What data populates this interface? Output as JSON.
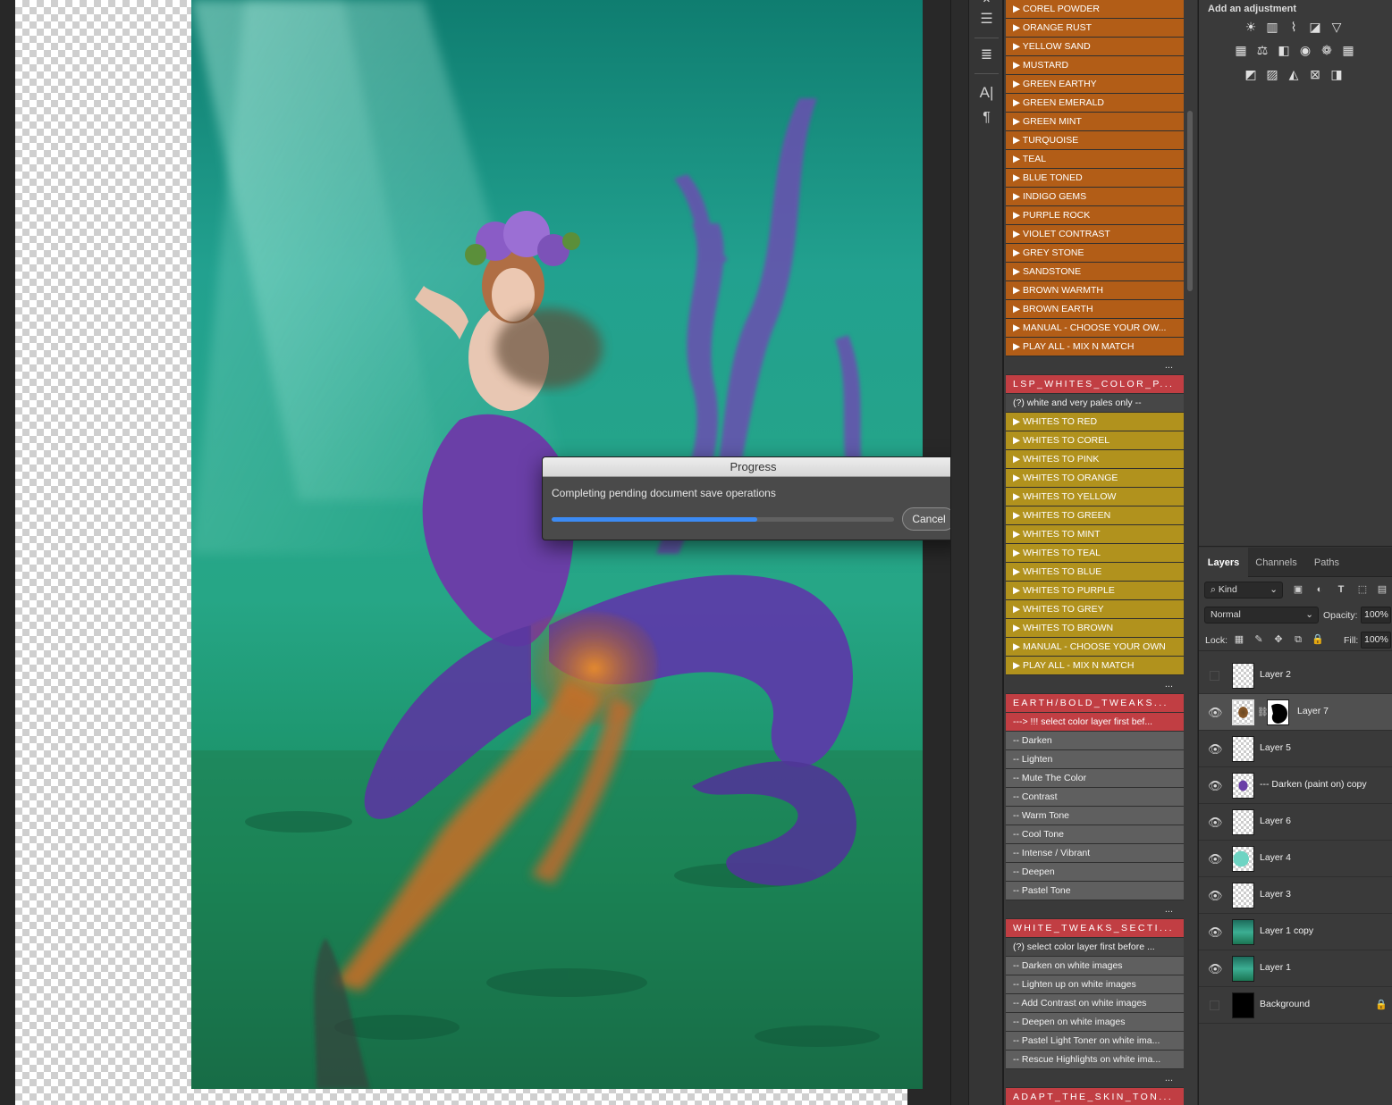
{
  "progress_dialog": {
    "title": "Progress",
    "message": "Completing pending document save operations",
    "progress_fraction": 0.6,
    "cancel_label": "Cancel"
  },
  "tool_dock": {
    "icons": [
      "history-icon",
      "properties-sliders-icon",
      "stamp-list-icon",
      "character-icon",
      "paragraph-icon"
    ]
  },
  "actions": {
    "more_label": "...",
    "rows": [
      {
        "label": "▶ COREL POWDER",
        "style": "orange"
      },
      {
        "label": "▶ ORANGE RUST",
        "style": "orange"
      },
      {
        "label": "▶ YELLOW SAND",
        "style": "orange"
      },
      {
        "label": "▶ MUSTARD",
        "style": "orange"
      },
      {
        "label": "▶ GREEN EARTHY",
        "style": "orange"
      },
      {
        "label": "▶ GREEN EMERALD",
        "style": "orange"
      },
      {
        "label": "▶ GREEN MINT",
        "style": "orange"
      },
      {
        "label": "▶ TURQUOISE",
        "style": "orange"
      },
      {
        "label": "▶ TEAL",
        "style": "orange"
      },
      {
        "label": "▶ BLUE TONED",
        "style": "orange"
      },
      {
        "label": "▶ INDIGO GEMS",
        "style": "orange"
      },
      {
        "label": "▶ PURPLE ROCK",
        "style": "orange"
      },
      {
        "label": "▶ VIOLET CONTRAST",
        "style": "orange"
      },
      {
        "label": "▶ GREY STONE",
        "style": "orange"
      },
      {
        "label": "▶ SANDSTONE",
        "style": "orange"
      },
      {
        "label": "▶ BROWN WARMTH",
        "style": "orange"
      },
      {
        "label": "▶ BROWN EARTH",
        "style": "orange"
      },
      {
        "label": "▶ MANUAL - CHOOSE YOUR OW...",
        "style": "orange"
      },
      {
        "label": "▶ PLAY ALL - MIX N MATCH",
        "style": "orange"
      },
      {
        "label": "...",
        "style": "more"
      },
      {
        "label": "LSP_WHITES_COLOR_P...",
        "style": "red"
      },
      {
        "label": "(?) white and very pales only --",
        "style": "dark"
      },
      {
        "label": "▶ WHITES TO  RED",
        "style": "mustard"
      },
      {
        "label": "▶ WHITES TO  COREL",
        "style": "mustard"
      },
      {
        "label": "▶ WHITES TO  PINK",
        "style": "mustard"
      },
      {
        "label": "▶ WHITES TO  ORANGE",
        "style": "mustard"
      },
      {
        "label": "▶ WHITES TO  YELLOW",
        "style": "mustard"
      },
      {
        "label": "▶ WHITES TO  GREEN",
        "style": "mustard"
      },
      {
        "label": "▶  WHITES TO  MINT",
        "style": "mustard"
      },
      {
        "label": "▶ WHITES TO  TEAL",
        "style": "mustard"
      },
      {
        "label": "▶ WHITES TO   BLUE",
        "style": "mustard"
      },
      {
        "label": "▶ WHITES TO  PURPLE",
        "style": "mustard"
      },
      {
        "label": "▶ WHITES TO  GREY",
        "style": "mustard"
      },
      {
        "label": "▶ WHITES TO  BROWN",
        "style": "mustard"
      },
      {
        "label": "▶ MANUAL - CHOOSE YOUR OWN",
        "style": "mustard"
      },
      {
        "label": "▶ PLAY ALL - MIX N MATCH",
        "style": "mustard"
      },
      {
        "label": "...",
        "style": "more"
      },
      {
        "label": "EARTH/BOLD_TWEAKS...",
        "style": "red"
      },
      {
        "label": "---> !!! select color layer first bef...",
        "style": "red-plain"
      },
      {
        "label": "-- Darken",
        "style": "gray"
      },
      {
        "label": "-- Lighten",
        "style": "gray"
      },
      {
        "label": "-- Mute The Color",
        "style": "gray"
      },
      {
        "label": "-- Contrast",
        "style": "gray"
      },
      {
        "label": "-- Warm Tone",
        "style": "gray"
      },
      {
        "label": "-- Cool Tone",
        "style": "gray"
      },
      {
        "label": "-- Intense / Vibrant",
        "style": "gray"
      },
      {
        "label": "-- Deepen",
        "style": "gray"
      },
      {
        "label": "-- Pastel Tone",
        "style": "gray"
      },
      {
        "label": "...",
        "style": "more"
      },
      {
        "label": "WHITE_TWEAKS_SECTI...",
        "style": "red"
      },
      {
        "label": "(?)  select color layer first before ...",
        "style": "dark"
      },
      {
        "label": "-- Darken on white images",
        "style": "gray"
      },
      {
        "label": "-- Lighten up on white images",
        "style": "gray"
      },
      {
        "label": "-- Add Contrast on white images",
        "style": "gray"
      },
      {
        "label": "-- Deepen on white images",
        "style": "gray"
      },
      {
        "label": "-- Pastel Light Toner on white ima...",
        "style": "gray"
      },
      {
        "label": "-- Rescue Highlights on white ima...",
        "style": "gray"
      },
      {
        "label": "...",
        "style": "more"
      },
      {
        "label": "ADAPT_THE_SKIN_TON...",
        "style": "red"
      }
    ]
  },
  "adjustments": {
    "title": "Add an adjustment",
    "icons": [
      "brightness-contrast-icon",
      "levels-icon",
      "curves-icon",
      "exposure-icon",
      "vibrance-icon",
      "hue-saturation-icon",
      "color-balance-icon",
      "black-white-icon",
      "photo-filter-icon",
      "channel-mixer-icon",
      "color-lookup-icon",
      "invert-icon",
      "posterize-icon",
      "threshold-icon",
      "selective-color-icon",
      "gradient-map-icon"
    ]
  },
  "layers_panel": {
    "tabs": [
      "Layers",
      "Channels",
      "Paths"
    ],
    "active_tab": "Layers",
    "kind_filter": "Kind",
    "blend_mode": "Normal",
    "opacity_label": "Opacity:",
    "opacity_value": "100%",
    "lock_label": "Lock:",
    "fill_label": "Fill:",
    "fill_value": "100%",
    "layers": [
      {
        "name": "Layer 2",
        "visible": false,
        "thumb": "checker",
        "selected": false
      },
      {
        "name": "Layer 7",
        "visible": true,
        "thumb": "brownfig",
        "mask": true,
        "selected": true
      },
      {
        "name": "Layer 5",
        "visible": true,
        "thumb": "checker",
        "selected": false
      },
      {
        "name": "--- Darken (paint on) copy",
        "visible": true,
        "thumb": "purplefig",
        "selected": false
      },
      {
        "name": "Layer 6",
        "visible": true,
        "thumb": "checker",
        "selected": false
      },
      {
        "name": "Layer 4",
        "visible": true,
        "thumb": "cyanpatch",
        "selected": false
      },
      {
        "name": "Layer 3",
        "visible": true,
        "thumb": "checker",
        "selected": false
      },
      {
        "name": "Layer 1 copy",
        "visible": true,
        "thumb": "teal",
        "selected": false
      },
      {
        "name": "Layer 1",
        "visible": true,
        "thumb": "teal",
        "selected": false
      },
      {
        "name": "Background",
        "visible": false,
        "thumb": "black",
        "locked": true,
        "selected": false
      }
    ]
  }
}
